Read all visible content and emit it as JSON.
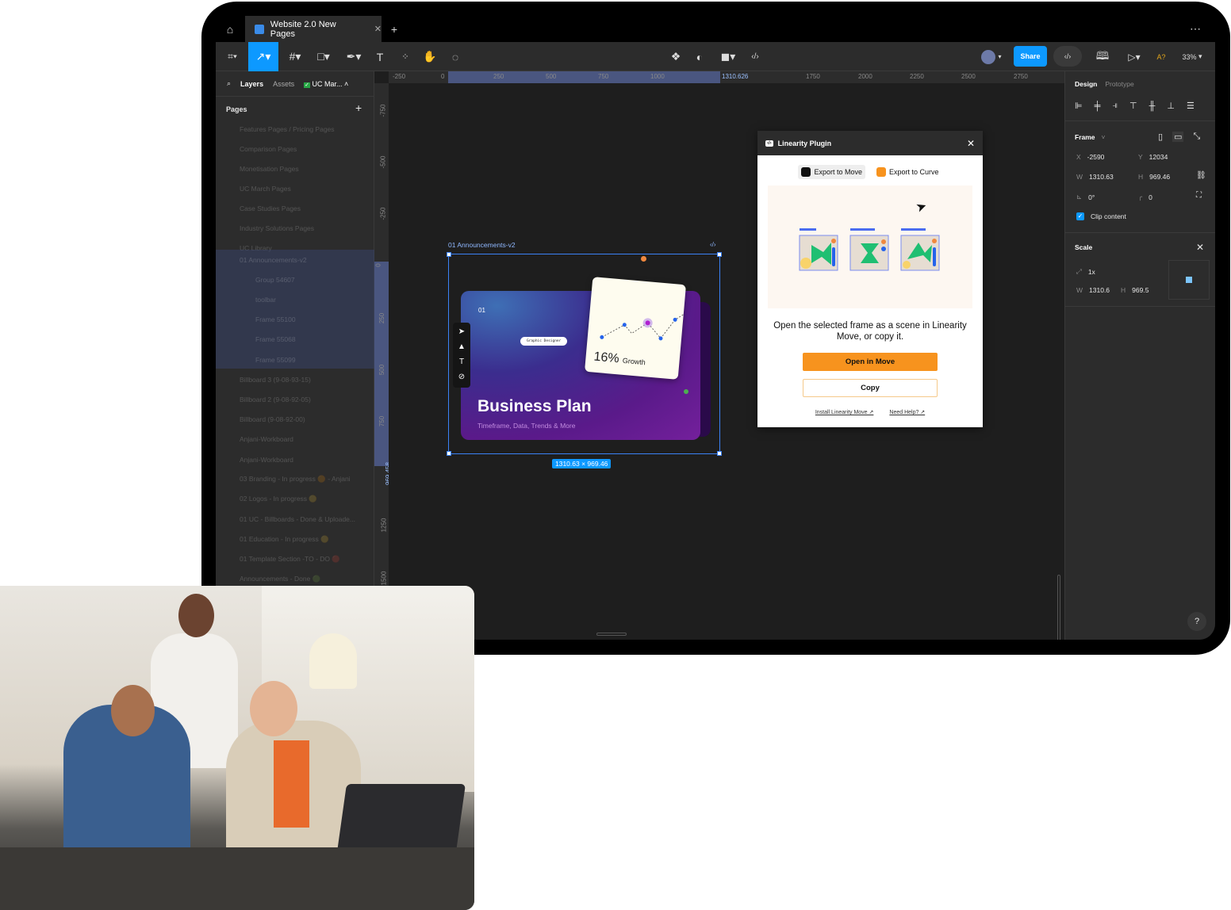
{
  "tab": {
    "title": "Website 2.0 New Pages"
  },
  "toolbar": {
    "share": "Share",
    "zoom": "33%",
    "ai": "A?"
  },
  "left_panel": {
    "tabs": [
      "Layers",
      "Assets"
    ],
    "page_select": "UC Mar...",
    "pages_header": "Pages",
    "pages": [
      "Features Pages / Pricing Pages",
      "Comparison Pages",
      "Monetisation Pages",
      "UC March Pages",
      "Case Studies Pages",
      "Industry Solutions Pages",
      "UC Library"
    ],
    "layers": [
      "01 Announcements-v2",
      "Group 54607",
      "toolbar",
      "Frame 55100",
      "Frame 55068",
      "Frame 55099",
      "Billboard 3 (9-08-93-15)",
      "Billboard 2 (9-08-92-05)",
      "Billboard (9-08-92-00)",
      "Anjani-Workboard",
      "Anjani-Workboard",
      "03 Branding - In progress 🟠 - Anjani",
      "02 Logos - In progress 🟡",
      "01 UC - Billboards - Done & Uploade...",
      "01 Education - In progress 🟡",
      "01 Template Section -TO - DO 🔴",
      "Announcements - Done 🟢"
    ]
  },
  "ruler": {
    "h": [
      "-250",
      "0",
      "250",
      "500",
      "750",
      "1000",
      "1310.626",
      "1750",
      "2000",
      "2250",
      "2500",
      "2750"
    ],
    "v": [
      "-750",
      "-500",
      "-250",
      "0",
      "250",
      "500",
      "750",
      "969.458",
      "1250",
      "1500"
    ]
  },
  "canvas": {
    "frame_label": "01 Announcements-v2",
    "size_badge": "1310.63 × 969.46",
    "card": {
      "number": "01",
      "tag": "Graphic Designer",
      "stat": "16%",
      "stat_label": "Growth",
      "title": "Business Plan",
      "subtitle": "Timeframe, Data, Trends & More"
    }
  },
  "plugin": {
    "title": "Linearity Plugin",
    "tabs": [
      "Export to Move",
      "Export to Curve"
    ],
    "description": "Open the selected frame as a scene in Linearity Move, or copy it.",
    "primary": "Open in Move",
    "secondary": "Copy",
    "links": [
      "Install Linearity Move ↗",
      "Need Help? ↗"
    ],
    "accent": "#f7931e"
  },
  "right_panel": {
    "tabs": [
      "Design",
      "Prototype"
    ],
    "frame_label": "Frame",
    "x_label": "X",
    "x": "-2590",
    "y_label": "Y",
    "y": "12034",
    "w_label": "W",
    "w": "1310.63",
    "h_label": "H",
    "h": "969.46",
    "rotation": "0°",
    "radius": "0",
    "clip": "Clip content",
    "clip_checked": true,
    "scale_header": "Scale",
    "scale": "1x",
    "scale_w": "1310.6",
    "scale_h": "969.5"
  },
  "help": "?"
}
